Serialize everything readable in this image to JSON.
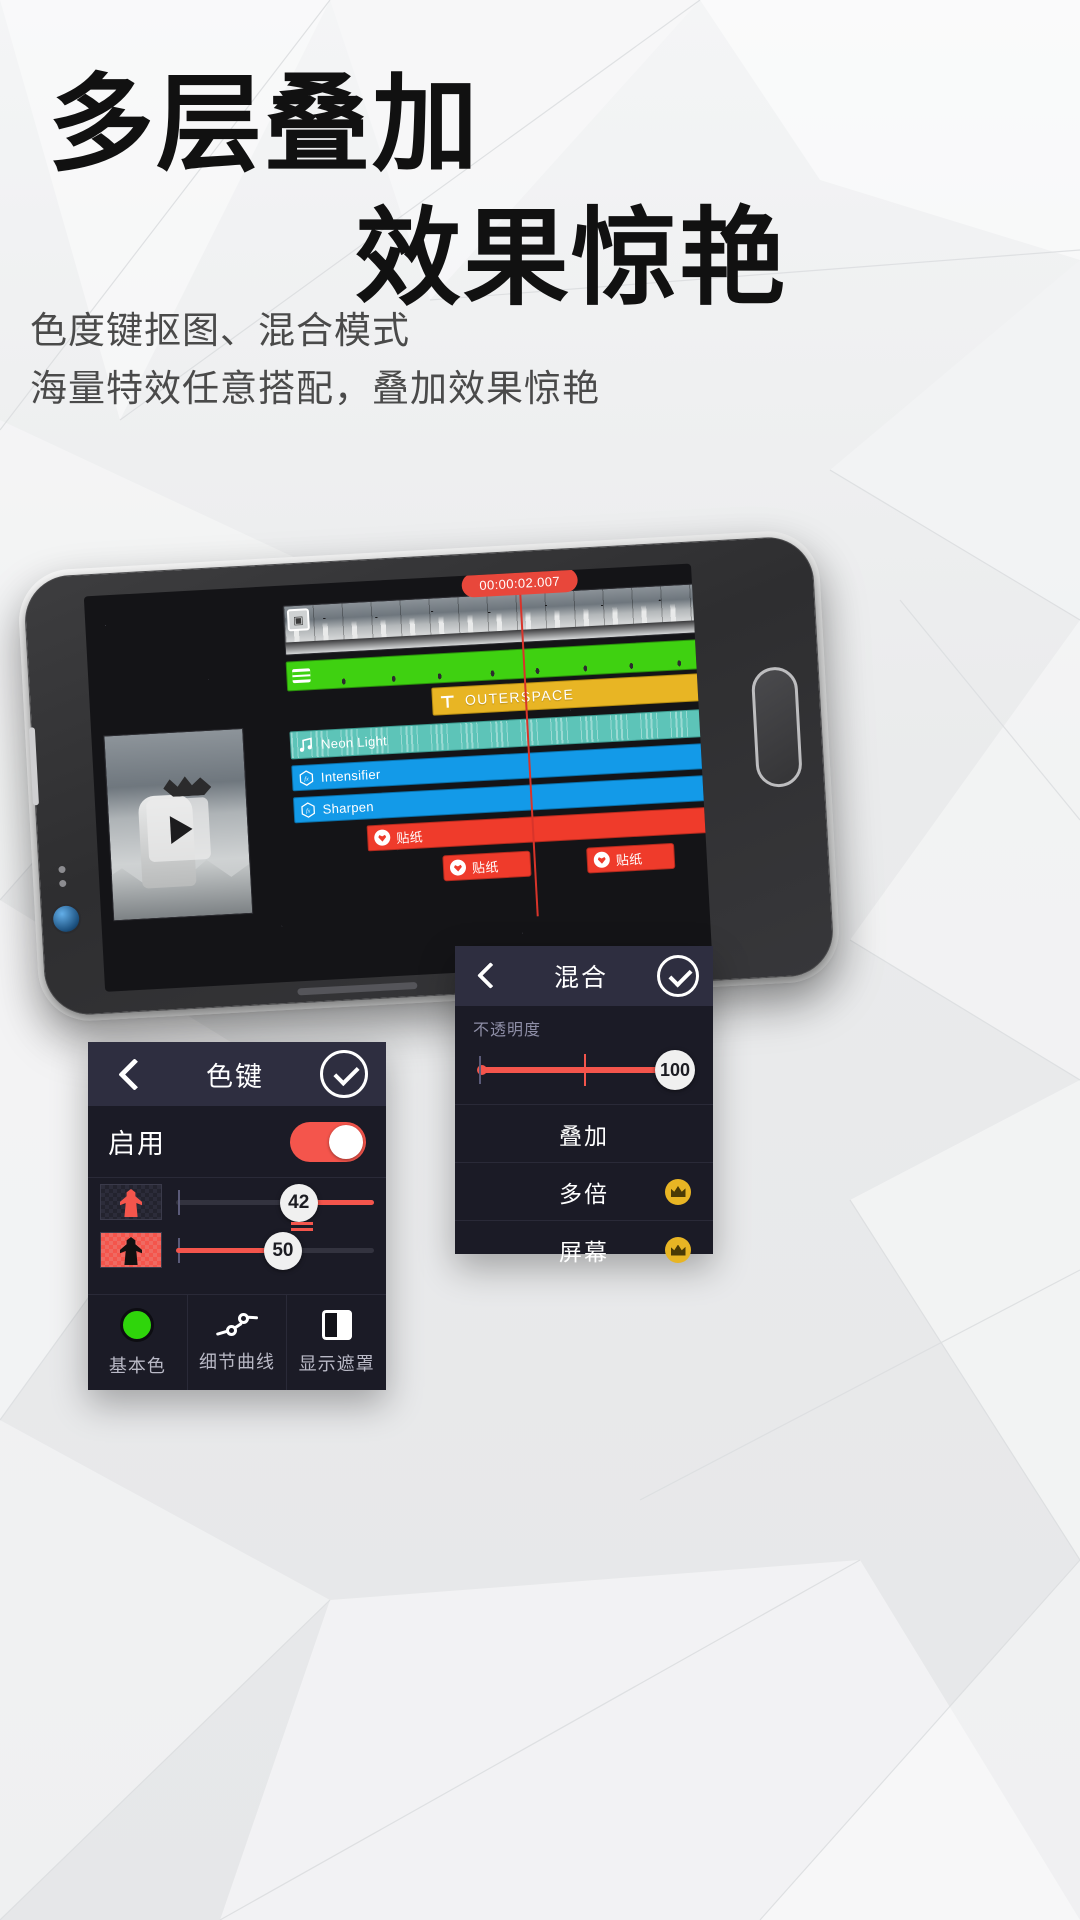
{
  "headline": {
    "line1": "多层叠加",
    "line2": "效果惊艳"
  },
  "subtitle": {
    "line1": "色度键抠图、混合模式",
    "line2": "海量特效任意搭配，叠加效果惊艳"
  },
  "phone": {
    "timeline": {
      "timecode": "00:00:02.007",
      "tracks": [
        {
          "name": "image-track",
          "icon": "image-icon",
          "label": ""
        },
        {
          "name": "video-track",
          "icon": "film-icon",
          "label": ""
        },
        {
          "name": "text-track",
          "icon": "text-T-icon",
          "label": "OUTERSPACE"
        },
        {
          "name": "audio-track",
          "icon": "music-note-icon",
          "label": "Neon Light"
        },
        {
          "name": "effect-track-1",
          "icon": "fx-hex-icon",
          "label": "Intensifier"
        },
        {
          "name": "effect-track-2",
          "icon": "fx-hex-icon",
          "label": "Sharpen"
        },
        {
          "name": "sticker-track-main",
          "icon": "sticker-heart-icon",
          "label": "贴纸"
        },
        {
          "name": "sticker-clip-1",
          "icon": "sticker-heart-icon",
          "label": "贴纸"
        },
        {
          "name": "sticker-clip-2",
          "icon": "sticker-heart-icon",
          "label": "贴纸"
        }
      ]
    }
  },
  "chroma_panel": {
    "title": "色键",
    "back_icon": "back-chevron-icon",
    "confirm_icon": "check-circle-icon",
    "enable_label": "启用",
    "enable_on": true,
    "sliders": [
      {
        "name": "threshold",
        "icon": "silhouette-transparent-icon",
        "value": "42"
      },
      {
        "name": "tolerance",
        "icon": "silhouette-filled-icon",
        "value": "50"
      }
    ],
    "buttons": [
      {
        "label": "基本色",
        "icon": "green-color-dot-icon"
      },
      {
        "label": "细节曲线",
        "icon": "curve-nodes-icon"
      },
      {
        "label": "显示遮罩",
        "icon": "mask-contrast-icon"
      }
    ]
  },
  "blend_panel": {
    "title": "混合",
    "back_icon": "back-chevron-icon",
    "confirm_icon": "check-circle-icon",
    "opacity_label": "不透明度",
    "opacity_value": "100",
    "modes": [
      {
        "label": "叠加",
        "premium": false
      },
      {
        "label": "多倍",
        "premium": true
      },
      {
        "label": "屏幕",
        "premium": true
      }
    ]
  },
  "colors": {
    "accent_red": "#f4554c",
    "track_green": "#3fd111",
    "track_blue": "#139ae8",
    "track_yellow": "#e8b524",
    "track_teal": "#5dc4b8",
    "track_red": "#ef3b2b",
    "panel_bg": "#1b1b26",
    "panel_header": "#2e2e40"
  }
}
